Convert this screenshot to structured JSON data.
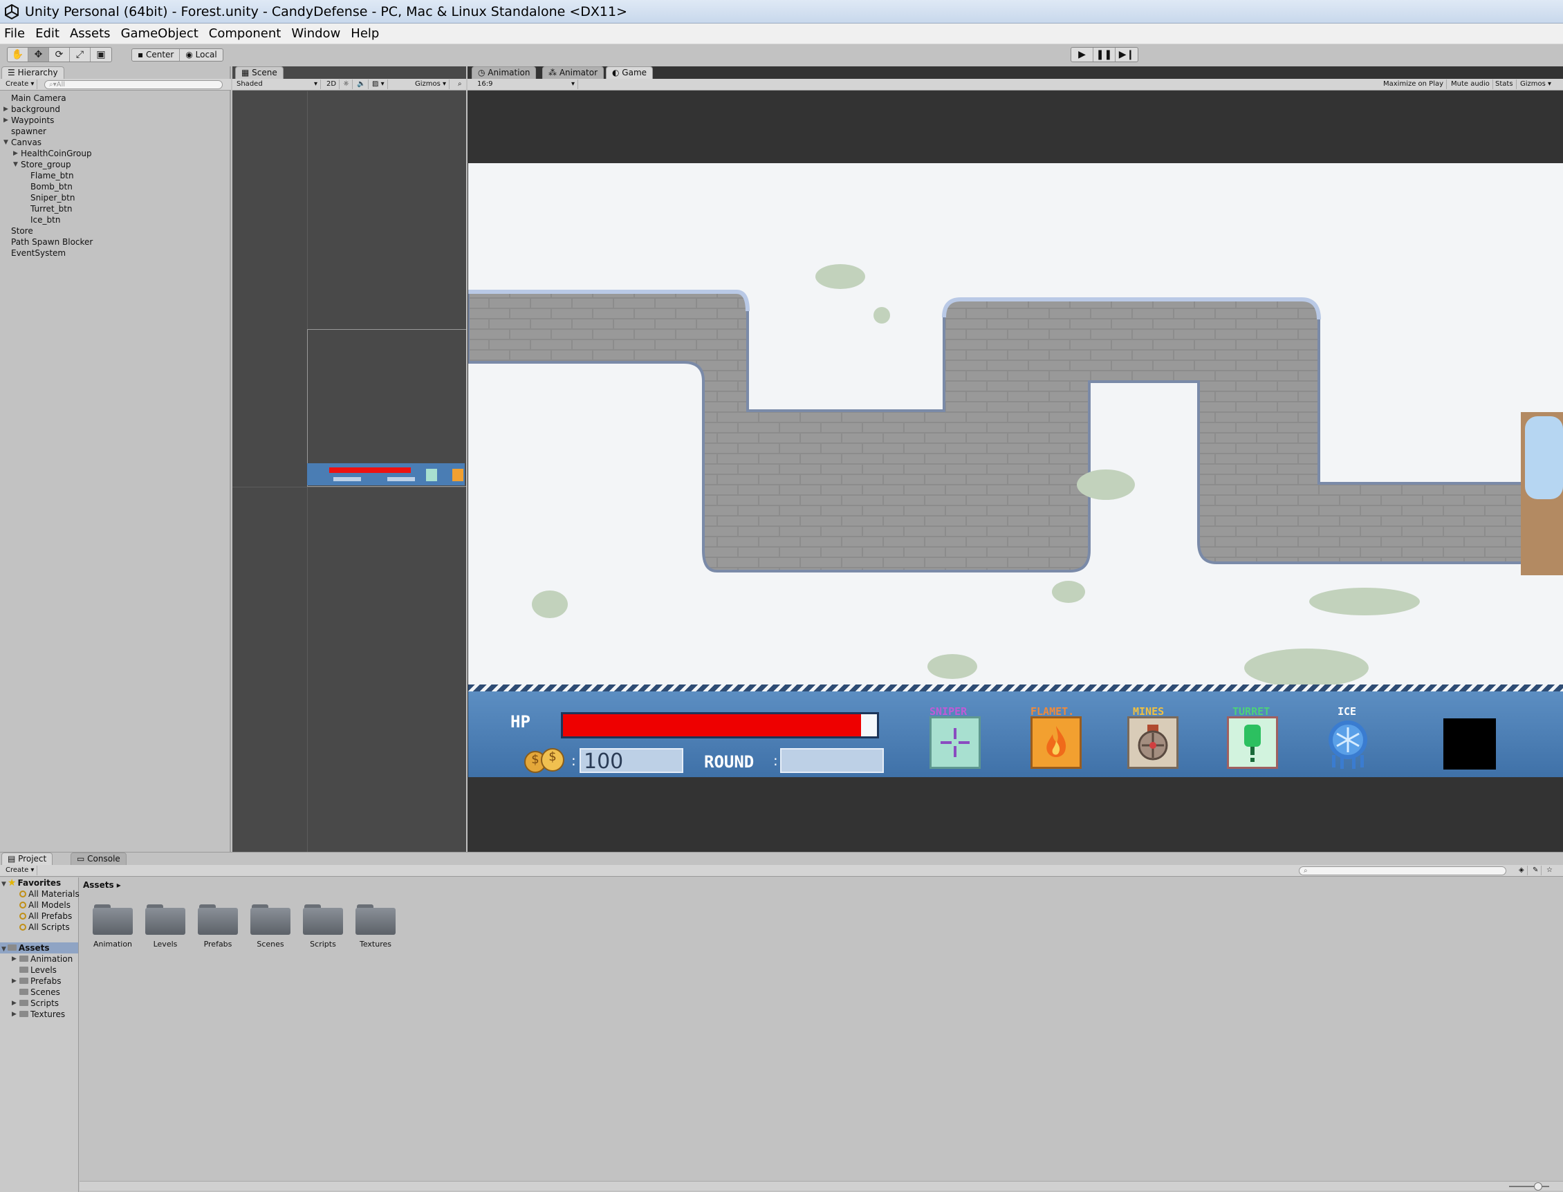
{
  "window": {
    "title": "Unity Personal (64bit) - Forest.unity - CandyDefense - PC, Mac & Linux Standalone <DX11>"
  },
  "menu": [
    "File",
    "Edit",
    "Assets",
    "GameObject",
    "Component",
    "Window",
    "Help"
  ],
  "toolbar": {
    "pivot": "Center",
    "space": "Local"
  },
  "hierarchy": {
    "tab": "Hierarchy",
    "create": "Create",
    "search_placeholder": "All",
    "items": [
      {
        "label": "Main Camera",
        "indent": 0,
        "arrow": ""
      },
      {
        "label": "background",
        "indent": 0,
        "arrow": "right"
      },
      {
        "label": "Waypoints",
        "indent": 0,
        "arrow": "right"
      },
      {
        "label": "spawner",
        "indent": 0,
        "arrow": ""
      },
      {
        "label": "Canvas",
        "indent": 0,
        "arrow": "down"
      },
      {
        "label": "HealthCoinGroup",
        "indent": 1,
        "arrow": "right"
      },
      {
        "label": "Store_group",
        "indent": 1,
        "arrow": "down"
      },
      {
        "label": "Flame_btn",
        "indent": 2,
        "arrow": ""
      },
      {
        "label": "Bomb_btn",
        "indent": 2,
        "arrow": ""
      },
      {
        "label": "Sniper_btn",
        "indent": 2,
        "arrow": ""
      },
      {
        "label": "Turret_btn",
        "indent": 2,
        "arrow": ""
      },
      {
        "label": "Ice_btn",
        "indent": 2,
        "arrow": ""
      },
      {
        "label": "Store",
        "indent": 0,
        "arrow": ""
      },
      {
        "label": "Path Spawn Blocker",
        "indent": 0,
        "arrow": ""
      },
      {
        "label": "EventSystem",
        "indent": 0,
        "arrow": ""
      }
    ]
  },
  "scene": {
    "tab": "Scene",
    "mode": "Shaded",
    "toggle_2d": "2D",
    "gizmos": "Gizmos"
  },
  "game": {
    "tabs": [
      "Animation",
      "Animator",
      "Game"
    ],
    "aspect": "16:9",
    "buttons": [
      "Maximize on Play",
      "Mute audio",
      "Stats",
      "Gizmos"
    ],
    "hud": {
      "hp_label": "HP",
      "hp_fraction": 0.95,
      "coin_value": "100",
      "round_label": "ROUND",
      "round_value": "",
      "shop": [
        {
          "label": "SNIPER",
          "color": "#c05ad6",
          "icon": "crosshair-icon"
        },
        {
          "label": "FLAMET.",
          "color": "#f08a3a",
          "icon": "flame-icon"
        },
        {
          "label": "MINES",
          "color": "#f0c040",
          "icon": "mine-icon"
        },
        {
          "label": "TURRET",
          "color": "#4cd07a",
          "icon": "turret-icon"
        },
        {
          "label": "ICE",
          "color": "#ffffff",
          "icon": "ice-icon"
        }
      ]
    }
  },
  "project": {
    "tabs": [
      "Project",
      "Console"
    ],
    "create": "Create",
    "favorites_label": "Favorites",
    "favorites": [
      "All Materials",
      "All Models",
      "All Prefabs",
      "All Scripts"
    ],
    "assets_label": "Assets",
    "tree": [
      {
        "label": "Animation",
        "arrow": "right"
      },
      {
        "label": "Levels",
        "arrow": ""
      },
      {
        "label": "Prefabs",
        "arrow": "right"
      },
      {
        "label": "Scenes",
        "arrow": ""
      },
      {
        "label": "Scripts",
        "arrow": "right"
      },
      {
        "label": "Textures",
        "arrow": "right"
      }
    ],
    "breadcrumb": "Assets",
    "folders": [
      "Animation",
      "Levels",
      "Prefabs",
      "Scenes",
      "Scripts",
      "Textures"
    ]
  }
}
